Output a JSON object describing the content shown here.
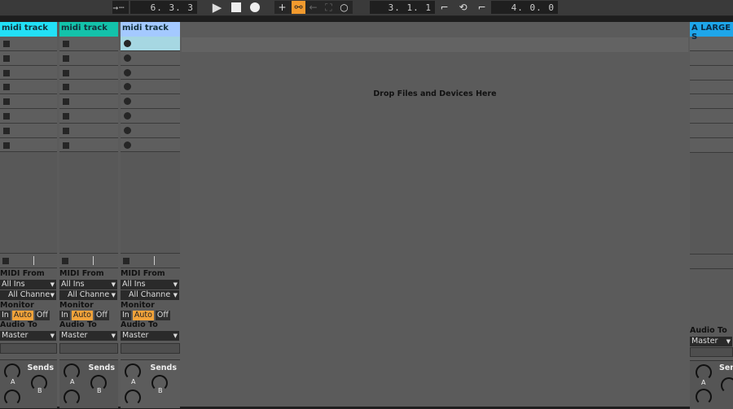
{
  "transport": {
    "arrangement_position": "6. 3. 3",
    "loop_start": "3. 1. 1",
    "loop_length": "4. 0. 0"
  },
  "drop_hint": "Drop Files and Devices Here",
  "tracks": [
    {
      "name": "midi track",
      "color": "#22e0f6",
      "slots": 8,
      "slot_type": "stop",
      "midi_from": "All Ins",
      "channel": "All Channe",
      "monitor_label": "Monitor",
      "monitor": [
        "In",
        "Auto",
        "Off"
      ],
      "monitor_active": "Auto",
      "audio_to_label": "Audio To",
      "audio_to": "Master",
      "midi_from_label": "MIDI From",
      "sends_label": "Sends",
      "send_a": "A",
      "send_b": "B"
    },
    {
      "name": "midi track",
      "color": "#13c2aa",
      "slots": 8,
      "slot_type": "stop",
      "midi_from": "All Ins",
      "channel": "All Channe",
      "monitor_label": "Monitor",
      "monitor": [
        "In",
        "Auto",
        "Off"
      ],
      "monitor_active": "Auto",
      "audio_to_label": "Audio To",
      "audio_to": "Master",
      "midi_from_label": "MIDI From",
      "sends_label": "Sends",
      "send_a": "A",
      "send_b": "B"
    },
    {
      "name": "midi track",
      "color": "#a4c9ff",
      "slots": 8,
      "slot_type": "record",
      "midi_from": "All Ins",
      "channel": "All Channe",
      "monitor_label": "Monitor",
      "monitor": [
        "In",
        "Auto",
        "Off"
      ],
      "monitor_active": "Auto",
      "audio_to_label": "Audio To",
      "audio_to": "Master",
      "midi_from_label": "MIDI From",
      "sends_label": "Sends",
      "send_a": "A",
      "send_b": "B"
    }
  ],
  "return_track": {
    "name": "A LARGE S",
    "color": "#1ea6ea",
    "audio_to_label": "Audio To",
    "audio_to": "Master",
    "sends_label": "Sends",
    "send_a": "A",
    "send_b": "B"
  }
}
